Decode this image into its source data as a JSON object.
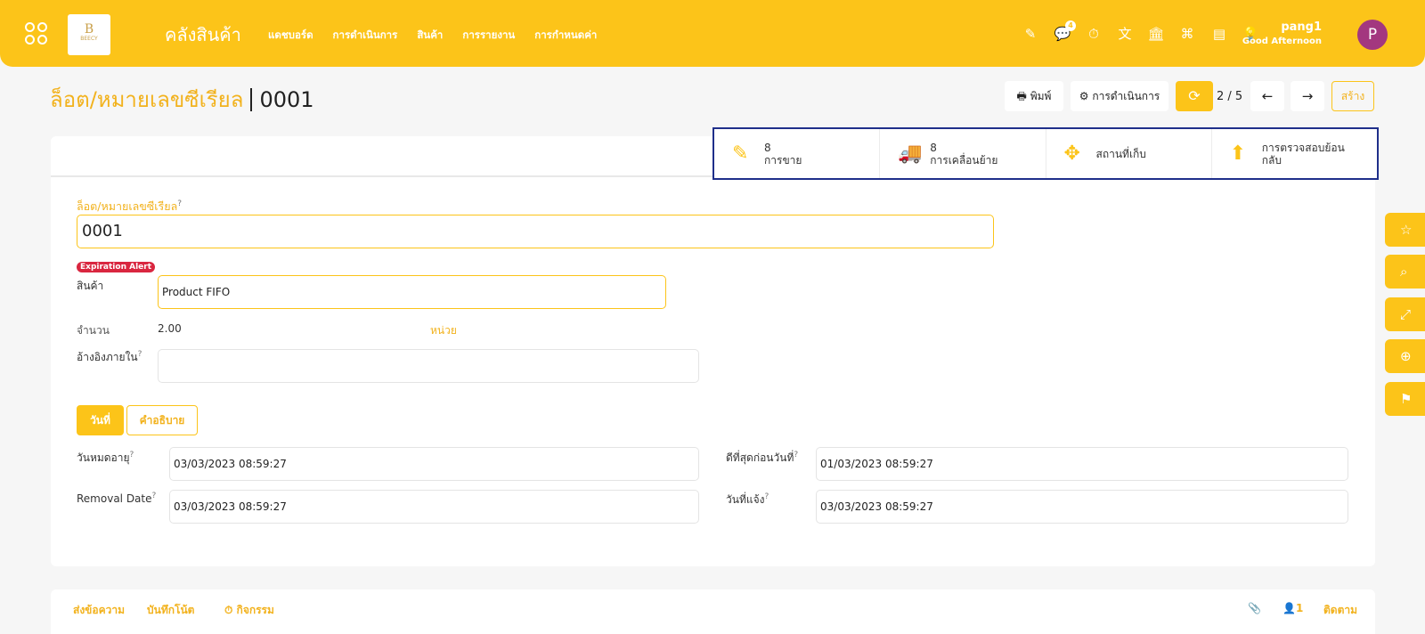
{
  "header": {
    "logo_text": "BEECY",
    "app_title": "คลังสินค้า",
    "nav": [
      "แดชบอร์ด",
      "การดำเนินการ",
      "สินค้า",
      "การรายงาน",
      "การกำหนดค่า"
    ],
    "notification_count": "4",
    "user_name": "pang1",
    "greeting": "Good Afternoon",
    "avatar_letter": "P",
    "accent_color": "#fcc419",
    "avatar_color": "#a3377f"
  },
  "breadcrumb": {
    "parent": "ล็อต/หมายเลขซีเรียล",
    "current": "0001"
  },
  "toolbar": {
    "print": "พิมพ์",
    "action": "การดำเนินการ",
    "pager": "2 / 5",
    "create": "สร้าง"
  },
  "stats": [
    {
      "count": "8",
      "label": "การขาย",
      "icon": "edit-icon"
    },
    {
      "count": "8",
      "label": "การเคลื่อนย้าย",
      "icon": "truck-icon"
    },
    {
      "count": "",
      "label": "สถานที่เก็บ",
      "icon": "move-arrows-icon"
    },
    {
      "count": "",
      "label": "การตรวจสอบย้อนกลับ",
      "icon": "arrow-up-icon"
    }
  ],
  "form": {
    "lot_label": "ล็อต/หมายเลขซีเรียล",
    "lot_value": "0001",
    "alert_badge": "Expiration Alert",
    "product_label": "สินค้า",
    "product_value": "Product FIFO",
    "qty_label": "จำนวน",
    "qty_value": "2.00",
    "uom": "หน่วย",
    "ref_label": "อ้างอิงภายใน",
    "ref_value": "",
    "help": "?"
  },
  "tabs": [
    "วันที่",
    "คำอธิบาย"
  ],
  "dates": {
    "expiry_label": "วันหมดอายุ",
    "expiry_value": "03/03/2023 08:59:27",
    "removal_label": "Removal Date",
    "removal_value": "03/03/2023 08:59:27",
    "best_before_label": "ดีที่สุดก่อนวันที่",
    "best_before_value": "01/03/2023 08:59:27",
    "alert_label": "วันที่แจ้ง",
    "alert_value": "03/03/2023 08:59:27"
  },
  "chatter": {
    "send": "ส่งข้อความ",
    "note": "บันทึกโน้ต",
    "activity": "กิจกรรม",
    "followers": "1",
    "follow": "ติดตาม"
  }
}
